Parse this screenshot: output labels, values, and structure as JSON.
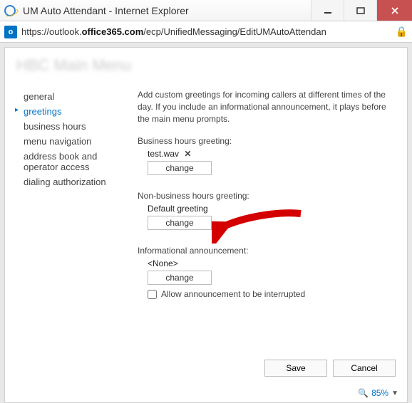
{
  "window": {
    "title": "UM Auto Attendant - Internet Explorer"
  },
  "address": {
    "scheme": "https://",
    "host_pre": "outlook.",
    "host_bold": "office365.com",
    "path": "/ecp/UnifiedMessaging/EditUMAutoAttendan"
  },
  "page_title": "HBC Main Menu",
  "sidebar": {
    "items": [
      {
        "label": "general"
      },
      {
        "label": "greetings"
      },
      {
        "label": "business hours"
      },
      {
        "label": "menu navigation"
      },
      {
        "label": "address book and operator access"
      },
      {
        "label": "dialing authorization"
      }
    ],
    "selected_index": 1
  },
  "main": {
    "intro": "Add custom greetings for incoming callers at different times of the day. If you include an informational announcement, it plays before the main menu prompts.",
    "business": {
      "label": "Business hours greeting:",
      "file": "test.wav",
      "clear": "✕",
      "change": "change"
    },
    "nonbusiness": {
      "label": "Non-business hours greeting:",
      "file": "Default greeting",
      "change": "change"
    },
    "informational": {
      "label": "Informational announcement:",
      "file": "<None>",
      "change": "change",
      "allow_interrupt_label": "Allow announcement to be interrupted",
      "allow_interrupt_checked": false
    }
  },
  "footer": {
    "save": "Save",
    "cancel": "Cancel"
  },
  "zoom": {
    "icon": "🔍",
    "value": "85%"
  }
}
